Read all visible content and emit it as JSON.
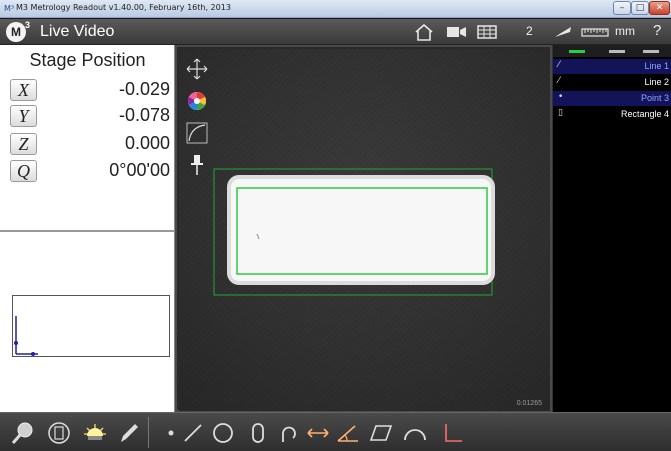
{
  "window": {
    "title": "M3 Metrology Readout  v1.40.00, February 16th, 2013",
    "min_glyph": "–",
    "max_glyph": "□",
    "close_glyph": "✕"
  },
  "toolbar": {
    "logo": "M",
    "logo_sup": "3",
    "mode_title": "Live Video",
    "count": "2",
    "unit": "mm",
    "help": "?",
    "icons": [
      "home-icon",
      "video-camera-icon",
      "grid-table-icon",
      "probe-icon",
      "ruler-icon"
    ]
  },
  "dro": {
    "title": "Stage Position",
    "axes": [
      {
        "label": "X",
        "value": "-0.029"
      },
      {
        "label": "Y",
        "value": "-0.078"
      },
      {
        "label": "Z",
        "value": "0.000"
      },
      {
        "label": "Q",
        "value": "0°00'00"
      }
    ]
  },
  "video": {
    "scale_readout": "0.01265",
    "tools": [
      "move-arrows-icon",
      "color-wheel-icon",
      "edge-tool-icon",
      "pin-icon"
    ]
  },
  "features": {
    "items": [
      {
        "label": "Line 1",
        "icon": "line-icon",
        "glyph": "⁄",
        "selected": true,
        "color": "#8fa8ff"
      },
      {
        "label": "Line 2",
        "icon": "line-icon",
        "glyph": "⁄",
        "selected": false,
        "color": "#ffffff"
      },
      {
        "label": "Point 3",
        "icon": "point-icon",
        "glyph": "•",
        "selected": true,
        "color": "#8fa8ff"
      },
      {
        "label": "Rectangle 4",
        "icon": "rectangle-icon",
        "glyph": "▯",
        "selected": false,
        "color": "#ffffff"
      }
    ]
  },
  "bottom_toolbar": {
    "left_tools": [
      "magnifier-icon",
      "crosshair-lens-icon",
      "light-icon",
      "pencil-icon"
    ],
    "measure_tools": [
      "point-icon",
      "line-icon",
      "circle-icon",
      "slot-icon",
      "arc-icon",
      "distance-icon",
      "angle-icon",
      "parallelogram-icon",
      "curve-icon",
      "skew-icon"
    ]
  },
  "colors": {
    "accent": "#2ecc40",
    "selected_feature_bg": "#13135a",
    "measure_icon": "#ffb070"
  }
}
